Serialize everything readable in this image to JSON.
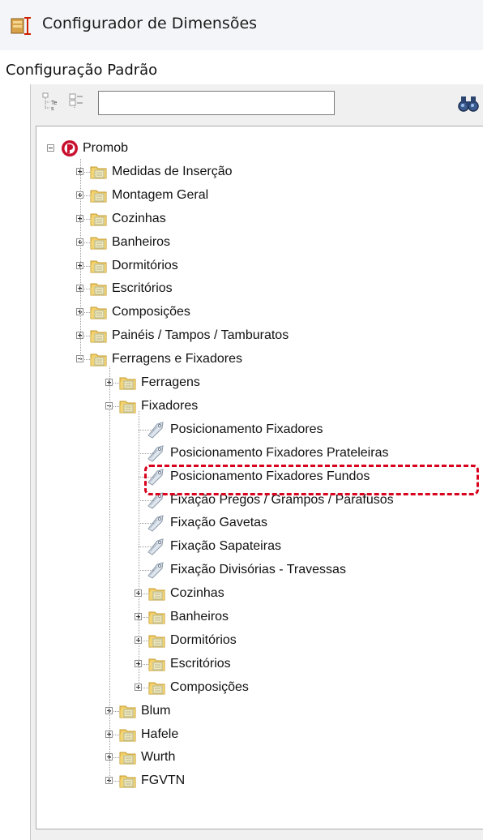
{
  "window": {
    "title": "Configurador de Dimensões",
    "app_icon": "dimension-configurator-icon"
  },
  "config_label": "Configuração Padrão",
  "toolbar": {
    "buttons": [
      {
        "name": "expand-all-icon"
      },
      {
        "name": "collapse-all-icon"
      }
    ],
    "search": {
      "value": "",
      "placeholder": ""
    },
    "find_icon": "binoculars-icon"
  },
  "tree": {
    "root": {
      "label": "Promob",
      "icon": "promob-logo-icon"
    },
    "items": [
      {
        "label": "Medidas de Inserção"
      },
      {
        "label": "Montagem Geral"
      },
      {
        "label": "Cozinhas"
      },
      {
        "label": "Banheiros"
      },
      {
        "label": "Dormitórios"
      },
      {
        "label": "Escritórios"
      },
      {
        "label": "Composições"
      },
      {
        "label": "Painéis / Tampos / Tamburatos"
      },
      {
        "label": "Ferragens e Fixadores"
      }
    ],
    "ferragens_children": [
      {
        "label": "Ferragens"
      },
      {
        "label": "Fixadores"
      }
    ],
    "fixadores_leaves": [
      {
        "label": "Posicionamento Fixadores"
      },
      {
        "label": "Posicionamento Fixadores Prateleiras"
      },
      {
        "label": "Posicionamento Fixadores Fundos"
      },
      {
        "label": "Fixação Pregos / Grampos / Parafusos"
      },
      {
        "label": "Fixação Gavetas"
      },
      {
        "label": "Fixação Sapateiras"
      },
      {
        "label": "Fixação Divisórias - Travessas"
      }
    ],
    "fixadores_folders": [
      {
        "label": "Cozinhas"
      },
      {
        "label": "Banheiros"
      },
      {
        "label": "Dormitórios"
      },
      {
        "label": "Escritórios"
      },
      {
        "label": "Composições"
      }
    ],
    "ferragens_more": [
      {
        "label": "Blum"
      },
      {
        "label": "Hafele"
      },
      {
        "label": "Wurth"
      },
      {
        "label": "FGVTN"
      }
    ]
  },
  "highlight": {
    "target": "Fixação Pregos / Grampos / Parafusos",
    "color": "#d8001c"
  }
}
